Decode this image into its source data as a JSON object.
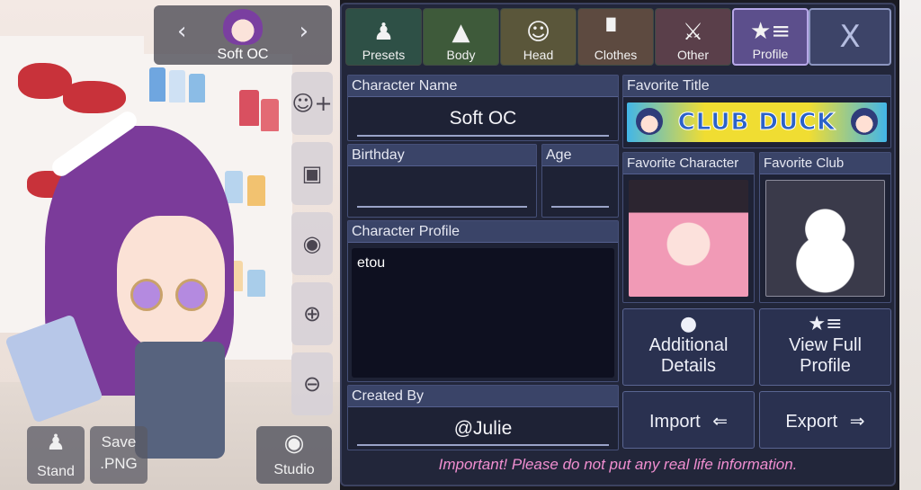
{
  "character_nav": {
    "prev_icon": "chevron-left-icon",
    "next_icon": "chevron-right-icon",
    "name": "Soft OC"
  },
  "side_tools": [
    {
      "icon": "add-user-icon",
      "glyph": "👤+"
    },
    {
      "icon": "image-icon",
      "glyph": "🖼"
    },
    {
      "icon": "eye-icon",
      "glyph": "◉"
    },
    {
      "icon": "zoom-in-icon",
      "glyph": "⊕"
    },
    {
      "icon": "zoom-out-icon",
      "glyph": "⊖"
    }
  ],
  "bottom_buttons": {
    "stand": "Stand",
    "save_line1": "Save",
    "save_line2": ".PNG",
    "studio": "Studio"
  },
  "tabs": [
    {
      "label": "Presets",
      "icon": "person-outline-icon",
      "glyph": "♟"
    },
    {
      "label": "Body",
      "icon": "jacket-icon",
      "glyph": "🧥"
    },
    {
      "label": "Head",
      "icon": "hair-icon",
      "glyph": "☺"
    },
    {
      "label": "Clothes",
      "icon": "shirt-icon",
      "glyph": "👕"
    },
    {
      "label": "Other",
      "icon": "sword-cat-icon",
      "glyph": "⚔"
    },
    {
      "label": "Profile",
      "icon": "star-list-icon",
      "glyph": "★≡"
    }
  ],
  "close_label": "X",
  "profile": {
    "character_name_label": "Character Name",
    "character_name": "Soft OC",
    "birthday_label": "Birthday",
    "birthday": "",
    "age_label": "Age",
    "age": "",
    "character_profile_label": "Character Profile",
    "character_profile": "etou",
    "created_by_label": "Created By",
    "created_by": "@Julie",
    "favorite_title_label": "Favorite Title",
    "favorite_title": "CLUB DUCK",
    "favorite_character_label": "Favorite Character",
    "favorite_club_label": "Favorite Club"
  },
  "actions": {
    "additional_details_l1": "Additional",
    "additional_details_l2": "Details",
    "view_full_l1": "View Full",
    "view_full_l2": "Profile",
    "import": "Import",
    "export": "Export"
  },
  "warning": "Important! Please do not put any real life information.",
  "colors": {
    "panel_bg": "#22263a",
    "header_bg": "#3a4468",
    "profile_tab": "#5c4f8c",
    "warning_text": "#f08ed0"
  }
}
